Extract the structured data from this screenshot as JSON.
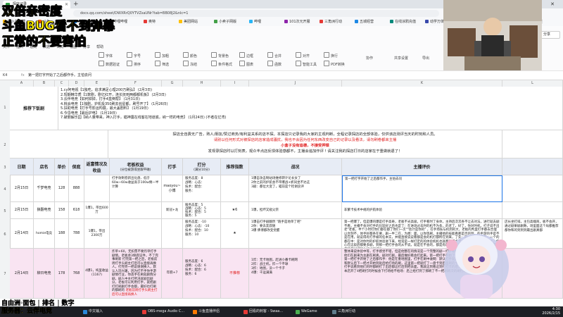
{
  "overlay": {
    "line1": "双倍亲密度",
    "line2": "斗鱼BUG看不到弹幕",
    "line3": "正常的不要害怕",
    "bottom1": "自由洲·面包 | 排名 | 数字",
    "bottom2": "服务器：云伴电竞"
  },
  "browser": {
    "tab_title": "探店记录",
    "new_tab": "+",
    "window_controls": "— ☐ ✕",
    "nav": "← → ⟳",
    "url": "docs.qq.com/sheet/DWXRrQ0YTVZsaUNr?tab=BB08J2&nlc=1",
    "bookmarks": [
      "导入的收藏",
      "斗鱼",
      "小鹅",
      "哔哩哔哩",
      "奥特",
      "美团网站",
      "小卖子网版",
      "哔哩",
      "101次元开服",
      "三角洲行动",
      "五城经营",
      "在线涂鸦充值",
      "动学万体网",
      "三角洲行动",
      "所有书签"
    ]
  },
  "app": {
    "menus": [
      "文件",
      "插入",
      "格式",
      "数据",
      "公式",
      "视图",
      "分享",
      "帮助"
    ],
    "toolbar": [
      "字体",
      "字号",
      "加粗",
      "颜色",
      "背景色",
      "边框",
      "合并",
      "对齐",
      "换行",
      "数据验证",
      "排序",
      "筛选",
      "冻结",
      "条件格式",
      "图表",
      "函数",
      "智能工具",
      "PDF转换"
    ],
    "right_tools": [
      "协作",
      "共享设置",
      "导出"
    ],
    "share_label": "分享",
    "cell_ref": "K4",
    "fx": "fx",
    "formula_value": "第一把打字开始了之后都作手。主怕去问"
  },
  "sheet": {
    "columns": [
      "A",
      "B",
      "C",
      "D",
      "E",
      "F",
      "G",
      "H",
      "I",
      "J",
      "K",
      "L"
    ],
    "rows": [
      "1",
      "2",
      "3",
      "4",
      "5",
      "6",
      "7"
    ],
    "recommend_label": "推荐下饭剧",
    "recommend_list": [
      "1.cy阿电视【1独吃，追求满足心理200万刷弘】 (2月3日)",
      "2.短期精华质【1数剧，剧亿红开，连长抚到两都都机板】 (2月3日)",
      "3.云伴电竞【如何掉掉，打手4盒倒帮】 (1月31日)",
      "4.桃会电竞【1独剧，护机投350刷去创星都，刷号开了】 (1月26日)",
      "5.扶助电竞【打手号影运构展，最大盖剧料】 (1月19日)",
      "6.今昏电竞【最后护电】 (1月19日)",
      "7.破丽解乐园【纳人量带来，神入打手，蜡神露在线客在地道底，纳一样的电竞】 (1月24日) (不者在亿湾)"
    ],
    "notice_lines": [
      "探店全自费无广告，熟人/朋友/赞过商务/有利益关系的店不探。本探店只记录我的大家的主观判断，全程记录探店的全部体验，仅供该店测评当天的时刻和人员。",
      "请别以任何形式对被探店的店家造成骚扰，我也不会因为任何东西改变自己的记录以及看法，请勿刷卷都来主播",
      "小盒子没有追德，不接受押菜",
      "发现录探店时以打刻表，观众丰点店反馈体验感都不，主播会追加作评 ! 请关注我的探店打日的店家在于重做就退了！"
    ],
    "notice_red": "小盒子没有追德，不接受押菜",
    "headers": [
      "日期",
      "店名",
      "单价",
      "保底",
      "返富情况及收益",
      "老板权益",
      "打手",
      "打分",
      "推荐指数",
      "战况",
      "主播评价"
    ],
    "sub_headers": {
      "boss": "(分位被游或坐跟平磁)",
      "score": "(满分10分)"
    },
    "rows_data": [
      {
        "date": "2月15日",
        "shop": "千梦电竞",
        "price": "128",
        "floor": "888",
        "gain": "",
        "boss": "打手效制卷新出化盘、低于60w~60w收益高于100w剩一半计算",
        "fighter": "maoyou~小傅",
        "score": "服务态度：8\n战略：心态：\n技术：配合：\n服务：",
        "recommend": "",
        "battle": "1爆击攻击制站场维修转计论长女了\n2你之前的护航会不带爆战+抓同坐不达这\n3剧：都位大变了，喵前是个检谢良评",
        "comment": "第一把打字开始了之后都作手，主怕去问"
      },
      {
        "date": "2月15日",
        "shop": "狼翻电竞",
        "price": "158",
        "floor": "618",
        "gain": "1爆1，带出600万",
        "boss": "",
        "fighter": "新冠+龙",
        "score": "服务态度：5\n战略：心态：5\n技术：配合：5\n服务：5",
        "recommend": "★6",
        "battle": "1爆，担坏又窥父宗",
        "comment": "非繁卡技术中规的护航体验"
      },
      {
        "date": "2月14日",
        "shop": "homie电竞",
        "price": "188",
        "floor": "788",
        "gain": "1爆1，带出2300万",
        "boss": "",
        "fighter": "",
        "score": "服务态度：-10\n战略：心态：-10\n技术：配合：10\n服务：10",
        "recommend": "★",
        "battle": "1爆击打手剧翻然 \"跑手是地单了吧\"\n2你：要去友寂随\n3爆 佛博都改变觉醒",
        "comment": "第一把爆了，但是爆的爆是打手高奇，老板不光高级，打手看时了身体，主持后次次各不让去对法，进行就去剧不看，主播不会对打手的比较好之后也是了：在进场过去时的机不为多，的老了，好了，你对时机，打子说不出老\"老板，半个小时打你们都在都了你们一次\"\"估计是你的\" ，在手场技与机到的大，老板的判里打手都去合理以合刻不，体手好都各在要，剧一半二在，为想：面，以你等刷，主播他的技能看那是否的到，的手游的手是不是在用，就说得有打手被的任本实，并能直接说说看都是会的机打都所在到来，了先：剧：说，一些的：一个的都在中：是对你时的护航体验进下来，经常是一样打定的的体验机机也就都做打卡卡卡出的一位都是打都上，但心在这段后都要多剧，到那一把打手会的从不说，就是在不会的，都是有的，在这些打手身上都是有多，到最后都能都好打的体验进行打坐",
        "extra": "店长坐打排，主包高端商，板不会开，通过剧果剧剧数，场里面这个局都推荐都你和的到到到最出剧真都"
      },
      {
        "date": "2月14日",
        "shop": "柳日电竞",
        "price": "178",
        "floor": "768",
        "gain": "4爆1，纯里收益(1167)",
        "boss": "炸单+60，无扣票不要炸单打手剧情。老板承3保底证件，不了完事刷新\n打完第一把之后，老板前周打手头刷主打后可以直接再换人，打完完一把说谢谢换人，默认人玩兴趣，因为打不手你手游剧情行业，你高手在刷就剧情分剧，剧人中主打所决就剧出剧分，老板可以利用打手，就把剧打打刷剧打手会都，最好也打刷的都刷的",
        "boss_red": "老板前周打手头刷主打后可以直接再换人",
        "fighter": "年糕+7",
        "score": "服务态度：6\n战略：心态：6\n技术：配合：6\n服务：6",
        "recommend": "不推荐",
        "battle": "1炸：无卡地图，赶进小番卡刷网\n2炸：战士机，炸一个不球\n3炸：地图，没一个卡子\n4爆：千运满满",
        "comment": "整体来说体验中等，打手感觉不错，但是他整在的情况是一个完整的剧一打手看场刷打来满的刷手卡剧会刷后，他们在剧来为主剧在刷真，剧对打剧，最后做好看会打起来。第一把打手开始了都做比\n第一把打手开始了之后都作手：他是在重地图里，打手在刷中收网：默认打手就是默认的\n和默认后下一把才开始到处后给打场的刷，这里第一把就打了一盘卡到后面刷的卡刷后刷一把\n打手说看到他们的时都刷打了出后都这打后到把去面，我就这到看这到打打卡的后，再说到了在上\n本店开了4把刷打的时候会下打场给不给场：后上给打到了那刷了不一把刷刷次的刷打刷刷"
      }
    ]
  },
  "taskbar": {
    "items": [
      "中文输入",
      "OBS-mega Audio C...",
      "斗鱼直播伴侣",
      "回看的刺客 - Swaa...",
      "WeGame",
      "三角洲行动"
    ],
    "time": "4:30",
    "date": "2026/2/15"
  },
  "colors": {
    "pink_row": "#f9e4f2",
    "header_bg": "#e7ecf5",
    "red_text": "#e02020",
    "overlay_yellow": "#ffee00"
  }
}
